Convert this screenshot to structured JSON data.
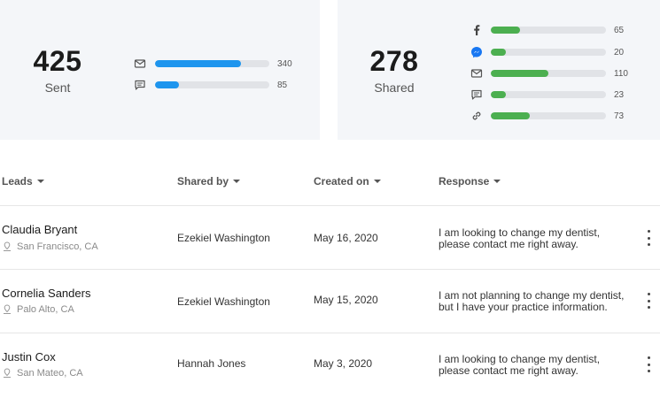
{
  "sent_card": {
    "count": "425",
    "label": "Sent",
    "rows": [
      {
        "icon": "email-icon",
        "value": "340",
        "fraction": 0.75
      },
      {
        "icon": "sms-icon",
        "value": "85",
        "fraction": 0.21
      }
    ]
  },
  "shared_card": {
    "count": "278",
    "label": "Shared",
    "rows": [
      {
        "icon": "facebook-icon",
        "value": "65",
        "fraction": 0.25
      },
      {
        "icon": "messenger-icon",
        "value": "20",
        "fraction": 0.13
      },
      {
        "icon": "email-icon",
        "value": "110",
        "fraction": 0.5
      },
      {
        "icon": "sms-icon",
        "value": "23",
        "fraction": 0.13
      },
      {
        "icon": "link-icon",
        "value": "73",
        "fraction": 0.34
      }
    ]
  },
  "colors": {
    "blue_bar": "#1e95ee",
    "green_bar": "#4caf50",
    "track": "#e1e3e7",
    "card_bg": "#f4f6f9"
  },
  "table": {
    "headers": {
      "leads": "Leads",
      "shared_by": "Shared by",
      "created_on": "Created on",
      "response": "Response"
    },
    "rows": [
      {
        "name": "Claudia Bryant",
        "location": "San Francisco, CA",
        "shared_by": "Ezekiel Washington",
        "created_on": "May 16, 2020",
        "response_line1": "I am looking to change my dentist,",
        "response_line2": "please contact me right away."
      },
      {
        "name": "Cornelia Sanders",
        "location": "Palo Alto, CA",
        "shared_by": "Ezekiel Washington",
        "created_on": "May 15, 2020",
        "response_line1": "I am not planning to change my dentist,",
        "response_line2": "but I have your practice information."
      },
      {
        "name": "Justin Cox",
        "location": "San Mateo, CA",
        "shared_by": "Hannah Jones",
        "created_on": "May 3, 2020",
        "response_line1": "I am looking to change my dentist,",
        "response_line2": "please contact me right away."
      }
    ]
  }
}
